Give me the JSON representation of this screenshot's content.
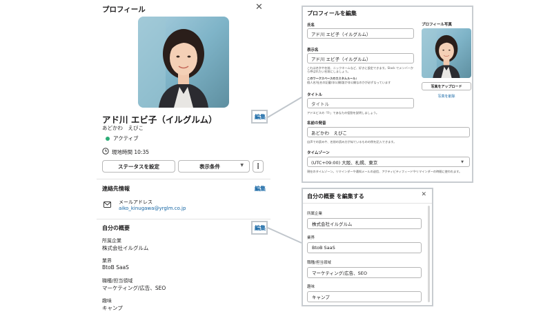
{
  "profile": {
    "panel_title": "プロフィール",
    "display_name": "アド川 エビ子（イルグルム）",
    "kana": "あどかわ　えびこ",
    "status": "アクティブ",
    "local_time": "現地時間 10:35",
    "set_status_button": "ステータスを設定",
    "view_options_button": "表示条件",
    "edit_link": "編集",
    "contact": {
      "title": "連絡先情報",
      "edit_link": "編集",
      "email_label": "メールアドレス",
      "email_value": "aiko_kinugawa@yrglm.co.jp"
    },
    "about": {
      "title": "自分の概要",
      "edit_link": "編集",
      "fields": [
        {
          "label": "所属企業",
          "value": "株式会社イルグルム"
        },
        {
          "label": "業界",
          "value": "BtoB SaaS"
        },
        {
          "label": "職種/担当領域",
          "value": "マーケティング/広告、SEO"
        },
        {
          "label": "趣味",
          "value": "キャンプ"
        }
      ]
    }
  },
  "edit_profile_modal": {
    "title": "プロフィールを編集",
    "full_name_label": "氏名",
    "full_name_value": "アド川 エビ子（イルグルム）",
    "display_name_label": "表示名",
    "display_name_value": "アド川 エビ子（イルグルム）",
    "display_name_help_1": "これは名字や名前、ニックネームなど、好きに設定できます。Slack でメンバーから呼ばれたい名前にしましょう。",
    "custom_rule_title": "このワークスペースのカスタムルール:",
    "custom_rule_text": "個人名/社名の記載/非公開/誰が非公開なのかが必ずなっています",
    "title_label": "タイトル",
    "title_placeholder": "タイトル",
    "title_help": "アドエビスの「Fr」であなたの役割を説明しましょう。",
    "pronunciation_label": "名前の発音",
    "pronunciation_value": "あどかわ　えびこ",
    "pronunciation_help": "自声での読みや、名前の読み方が似ているものの例を記入できます。",
    "timezone_label": "タイムゾーン",
    "timezone_value": "(UTC+09:00) 大阪、札幌、東京",
    "timezone_help": "現在のタイムゾーン。リマインダーや通知メールの送信、アクティビティフィードやリマインダーの時間に使われます。",
    "photo_label": "プロフィール写真",
    "upload_button": "写真をアップロード",
    "remove_link": "写真を削除"
  },
  "about_modal": {
    "title": "自分の概要 を編集する",
    "fields": [
      {
        "label": "所属企業",
        "value": "株式会社イルグルム"
      },
      {
        "label": "業界",
        "value": "BtoB SaaS"
      },
      {
        "label": "職種/担当領域",
        "value": "マーケティング/広告、SEO"
      },
      {
        "label": "趣味",
        "value": "キャンプ"
      }
    ]
  },
  "icons": [
    "close-icon",
    "clock-icon",
    "mail-icon",
    "chevron-down-icon",
    "more-vertical-icon"
  ],
  "colors": {
    "link": "#1264a3",
    "active": "#2bac76",
    "highlight_border": "#c0c6cc"
  }
}
